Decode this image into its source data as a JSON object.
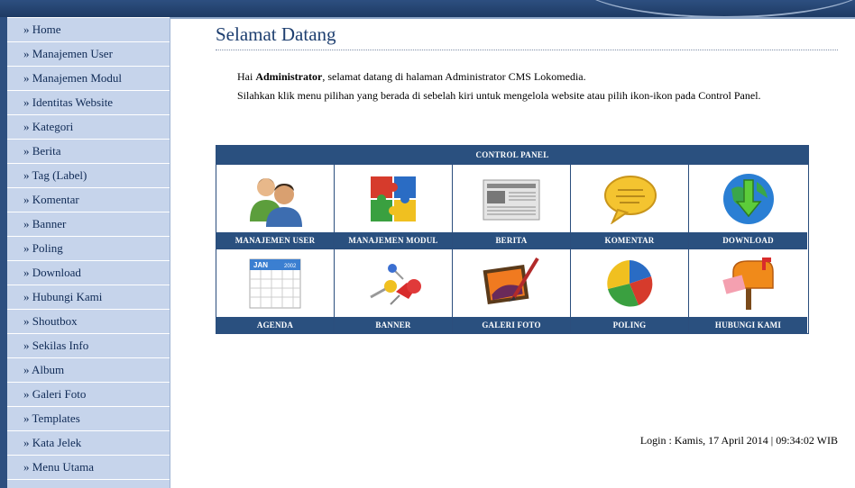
{
  "sidebar": {
    "items": [
      {
        "label": "» Home"
      },
      {
        "label": "» Manajemen User"
      },
      {
        "label": "» Manajemen Modul"
      },
      {
        "label": "» Identitas Website"
      },
      {
        "label": "» Kategori"
      },
      {
        "label": "» Berita"
      },
      {
        "label": "» Tag (Label)"
      },
      {
        "label": "» Komentar"
      },
      {
        "label": "» Banner"
      },
      {
        "label": "» Poling"
      },
      {
        "label": "» Download"
      },
      {
        "label": "» Hubungi Kami"
      },
      {
        "label": "» Shoutbox"
      },
      {
        "label": "» Sekilas Info"
      },
      {
        "label": "» Album"
      },
      {
        "label": "» Galeri Foto"
      },
      {
        "label": "» Templates"
      },
      {
        "label": "» Kata Jelek"
      },
      {
        "label": "» Menu Utama"
      }
    ]
  },
  "main": {
    "title": "Selamat Datang",
    "welcome": {
      "greeting": "Hai ",
      "user": "Administrator",
      "line1_rest": ", selamat datang di halaman Administrator CMS Lokomedia.",
      "line2": "Silahkan klik menu pilihan yang berada di sebelah kiri untuk mengelola website atau pilih ikon-ikon pada Control Panel."
    },
    "control_panel": {
      "title": "CONTROL PANEL",
      "items": [
        {
          "label": "MANAJEMEN USER",
          "icon": "users-icon"
        },
        {
          "label": "MANAJEMEN MODUL",
          "icon": "puzzle-icon"
        },
        {
          "label": "BERITA",
          "icon": "newspaper-icon"
        },
        {
          "label": "KOMENTAR",
          "icon": "speech-bubble-icon"
        },
        {
          "label": "DOWNLOAD",
          "icon": "globe-download-icon"
        },
        {
          "label": "AGENDA",
          "icon": "calendar-icon",
          "calendar_month": "JAN",
          "calendar_year": "2002"
        },
        {
          "label": "BANNER",
          "icon": "pushpin-icon"
        },
        {
          "label": "GALERI FOTO",
          "icon": "picture-brush-icon"
        },
        {
          "label": "POLING",
          "icon": "pie-chart-icon"
        },
        {
          "label": "HUBUNGI KAMI",
          "icon": "mailbox-icon"
        }
      ]
    },
    "login_info": "Login : Kamis, 17 April 2014 | 09:34:02 WIB"
  },
  "colors": {
    "header_blue": "#2a507f",
    "sidebar_bg": "#c6d4eb",
    "title_blue": "#1e3f70"
  }
}
